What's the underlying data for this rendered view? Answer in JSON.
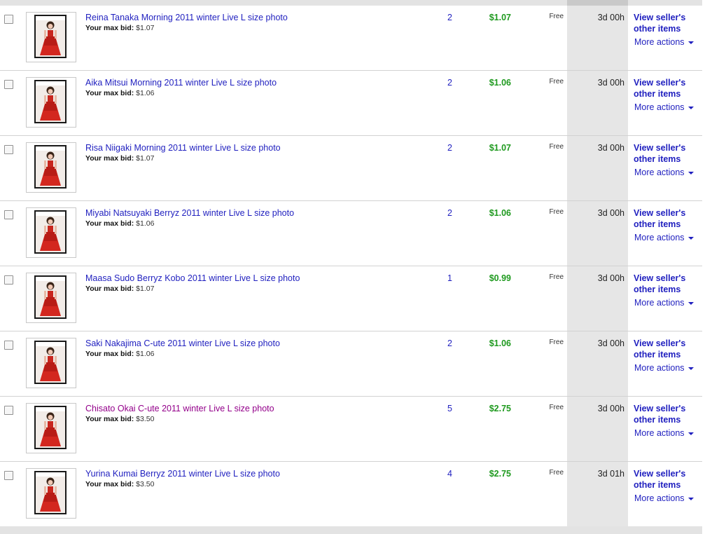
{
  "labels": {
    "max_bid": "Your max bid:",
    "seller_link": "View seller's other items",
    "more_actions": "More actions"
  },
  "colors": {
    "link": "#1f1fbf",
    "visited_link": "#93008a",
    "price": "#1f9a1f",
    "time_column_bg": "#e6e6e6",
    "row_divider": "#d2d2d2"
  },
  "icons": {
    "more_actions": "chevron-down-icon"
  },
  "items": [
    {
      "title": "Reina Tanaka Morning 2011 winter Live L size photo",
      "visited": false,
      "max_bid": "$1.07",
      "bids": "2",
      "price": "$1.07",
      "shipping": "Free",
      "time_left": "3d 00h",
      "checked": false
    },
    {
      "title": "Aika Mitsui Morning 2011 winter Live L size photo",
      "visited": false,
      "max_bid": "$1.06",
      "bids": "2",
      "price": "$1.06",
      "shipping": "Free",
      "time_left": "3d 00h",
      "checked": false
    },
    {
      "title": "Risa Niigaki Morning 2011 winter Live L size photo",
      "visited": false,
      "max_bid": "$1.07",
      "bids": "2",
      "price": "$1.07",
      "shipping": "Free",
      "time_left": "3d 00h",
      "checked": false
    },
    {
      "title": "Miyabi Natsuyaki Berryz 2011 winter Live L size photo",
      "visited": false,
      "max_bid": "$1.06",
      "bids": "2",
      "price": "$1.06",
      "shipping": "Free",
      "time_left": "3d 00h",
      "checked": false
    },
    {
      "title": "Maasa Sudo Berryz Kobo 2011 winter Live L size photo",
      "visited": false,
      "max_bid": "$1.07",
      "bids": "1",
      "price": "$0.99",
      "shipping": "Free",
      "time_left": "3d 00h",
      "checked": false
    },
    {
      "title": "Saki Nakajima C-ute 2011 winter Live L size photo",
      "visited": false,
      "max_bid": "$1.06",
      "bids": "2",
      "price": "$1.06",
      "shipping": "Free",
      "time_left": "3d 00h",
      "checked": false
    },
    {
      "title": "Chisato Okai C-ute 2011 winter Live L size photo",
      "visited": true,
      "max_bid": "$3.50",
      "bids": "5",
      "price": "$2.75",
      "shipping": "Free",
      "time_left": "3d 00h",
      "checked": false
    },
    {
      "title": "Yurina Kumai Berryz 2011 winter Live L size photo",
      "visited": false,
      "max_bid": "$3.50",
      "bids": "4",
      "price": "$2.75",
      "shipping": "Free",
      "time_left": "3d 01h",
      "checked": false
    }
  ]
}
